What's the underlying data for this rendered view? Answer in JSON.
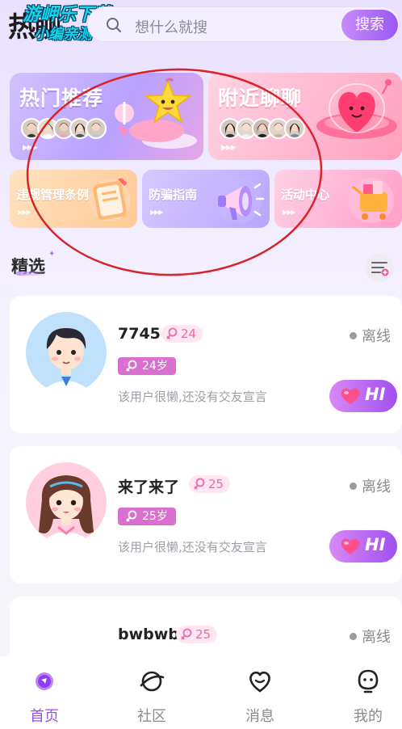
{
  "app": {
    "logo_text": "热聊"
  },
  "watermark": {
    "line1": "游岬乐下载",
    "line2": "小编亲测"
  },
  "search": {
    "placeholder": "想什么就搜",
    "button_label": "搜索"
  },
  "banners": [
    {
      "title": "热门推荐",
      "color": "#b9a1ff"
    },
    {
      "title": "附近聊聊",
      "color": "#ffb5cf"
    }
  ],
  "small_cards": [
    {
      "title": "违规管理条例"
    },
    {
      "title": "防骗指南"
    },
    {
      "title": "活动中心"
    }
  ],
  "section": {
    "title": "精选"
  },
  "users": [
    {
      "name": "7745",
      "tag": "24",
      "age": "24岁",
      "bio": "该用户很懒,还没有交友宣言",
      "status": "离线",
      "hi_label": "HI"
    },
    {
      "name": "来了来了",
      "tag": "25",
      "age": "25岁",
      "bio": "该用户很懒,还没有交友宣言",
      "status": "离线",
      "hi_label": "HI"
    },
    {
      "name": "bwbwb",
      "tag": "25",
      "status": "离线"
    }
  ],
  "nav": [
    {
      "label": "首页",
      "icon": "home-planet-icon",
      "active": true
    },
    {
      "label": "社区",
      "icon": "planet-icon",
      "active": false
    },
    {
      "label": "消息",
      "icon": "heart-chat-icon",
      "active": false
    },
    {
      "label": "我的",
      "icon": "ghost-face-icon",
      "active": false
    }
  ],
  "colors": {
    "accent": "#9a4ff0",
    "female_tag": "#f06aa6",
    "annotation": "#d8232a"
  }
}
